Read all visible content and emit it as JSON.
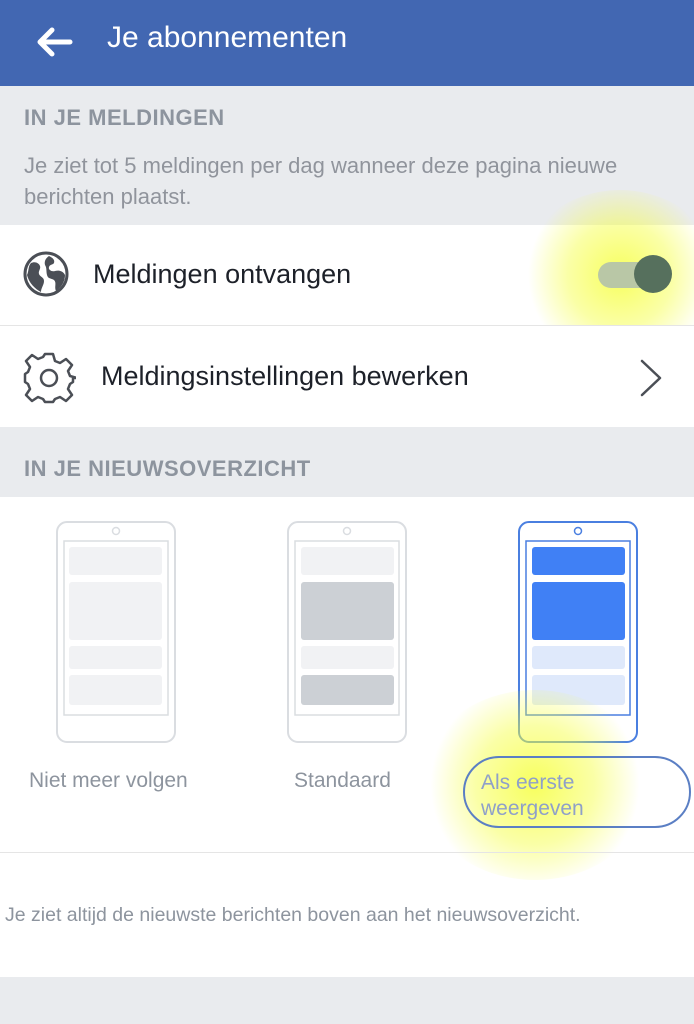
{
  "header": {
    "title": "Je abonnementen",
    "back_icon": "arrow-left-icon",
    "color": "#4267b2"
  },
  "notifications_section": {
    "title": "IN JE MELDINGEN",
    "description": "Je ziet tot 5 meldingen per dag wanneer deze pagina nieuwe berichten plaatst."
  },
  "receive_notifications": {
    "icon": "globe-icon",
    "label": "Meldingen ontvangen",
    "toggle_on": true
  },
  "notification_settings": {
    "icon": "gear-icon",
    "label": "Meldingsinstellingen bewerken",
    "chevron": "chevron-right-icon"
  },
  "newsfeed_section": {
    "title": "IN JE NIEUWSOVERZICHT",
    "options": [
      {
        "label": "Niet meer volgen",
        "selected": false
      },
      {
        "label": "Standaard",
        "selected": false
      },
      {
        "label": "Als eerste weergeven",
        "selected": true
      }
    ],
    "footnote": "Je ziet altijd de nieuwste berichten boven aan het nieuwsoverzicht."
  },
  "colors": {
    "accent": "#4267b2",
    "selected_blue": "#4080f5"
  }
}
